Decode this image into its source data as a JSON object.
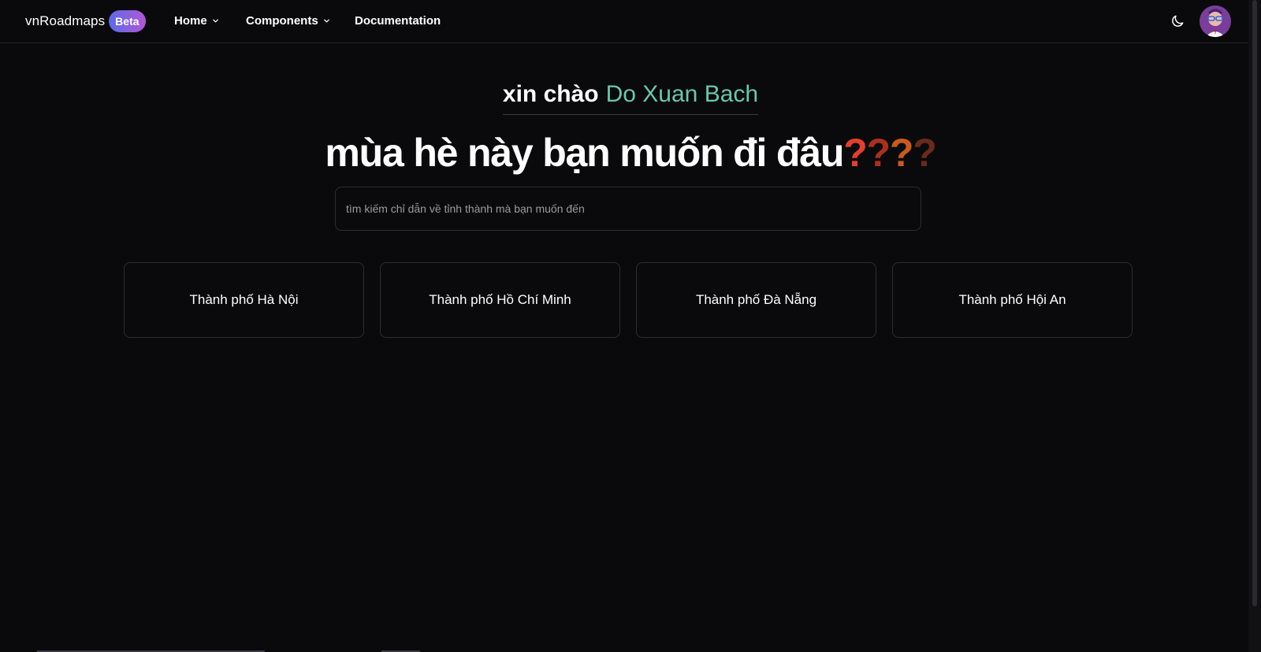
{
  "header": {
    "brand_name": "vnRoadmaps",
    "badge": "Beta",
    "nav": [
      {
        "label": "Home"
      },
      {
        "label": "Components"
      },
      {
        "label": "Documentation"
      }
    ],
    "theme_toggle_icon": "moon-icon",
    "avatar_icon": "user-avatar"
  },
  "hero": {
    "greeting_prefix": "xin chào",
    "user_name": "Do Xuan Bach",
    "headline_text": "mùa hè này bạn muốn đi đâu",
    "question_marks": [
      "?",
      "?",
      "?",
      "?"
    ],
    "question_mark_colors": [
      "#e0402f",
      "#a8301f",
      "#c65a1f",
      "#6b2a1c"
    ]
  },
  "search": {
    "placeholder": "tìm kiếm chỉ dẫn về tỉnh thành mà bạn muốn đến",
    "value": ""
  },
  "cities": [
    {
      "label": "Thành phố Hà Nội"
    },
    {
      "label": "Thành phố Hồ Chí Minh"
    },
    {
      "label": "Thành phố Đà Nẵng"
    },
    {
      "label": "Thành phố Hội An"
    }
  ],
  "colors": {
    "background": "#0a0a0c",
    "accent_name": "#6cc6a6",
    "badge_gradient_start": "#5b6be8",
    "badge_gradient_end": "#b357d4",
    "border": "#2c2c34"
  }
}
